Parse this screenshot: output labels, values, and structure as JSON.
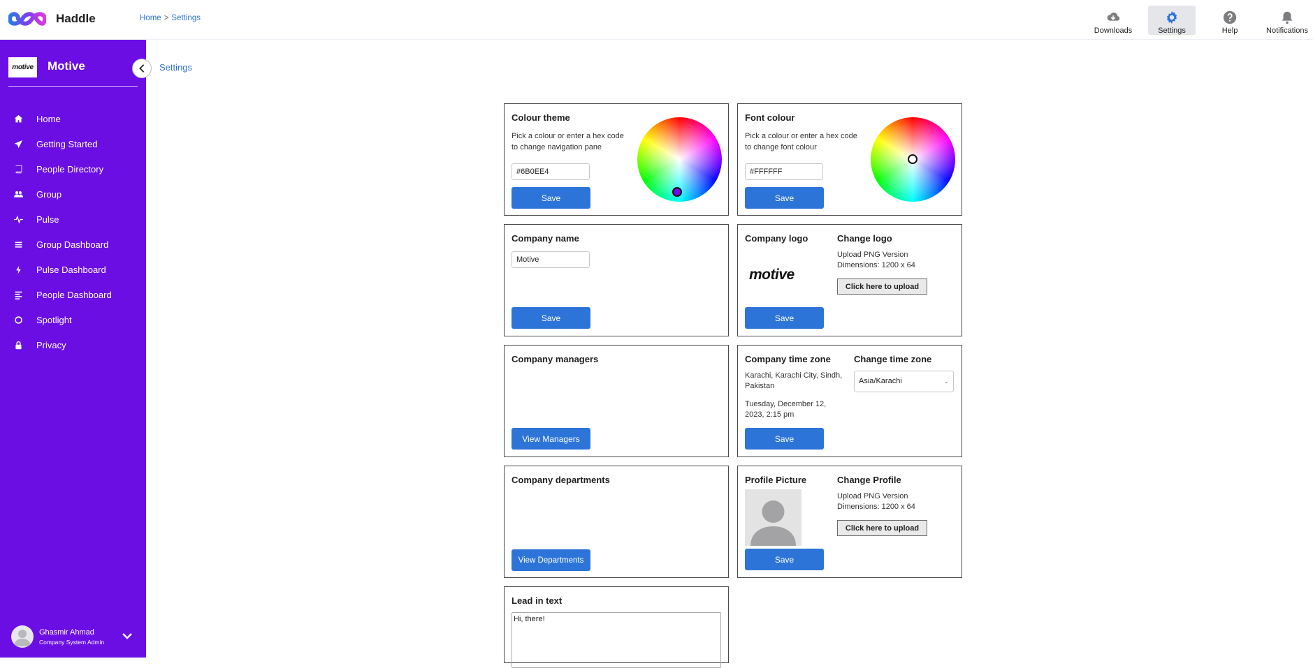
{
  "app": {
    "name": "Haddle"
  },
  "breadcrumb": {
    "home": "Home",
    "sep": ">",
    "current": "Settings"
  },
  "topnav": [
    {
      "label": "Downloads",
      "icon": "cloud-download-icon"
    },
    {
      "label": "Settings",
      "icon": "gear-icon",
      "active": true
    },
    {
      "label": "Help",
      "icon": "help-icon"
    },
    {
      "label": "Notifications",
      "icon": "bell-icon"
    }
  ],
  "sidebar": {
    "company_logo_text": "motive",
    "company_name": "Motive",
    "items": [
      {
        "label": "Home",
        "icon": "home-icon"
      },
      {
        "label": "Getting Started",
        "icon": "paper-plane-icon"
      },
      {
        "label": "People Directory",
        "icon": "book-icon"
      },
      {
        "label": "Group",
        "icon": "users-icon"
      },
      {
        "label": "Pulse",
        "icon": "pulse-icon"
      },
      {
        "label": "Group Dashboard",
        "icon": "list-icon"
      },
      {
        "label": "Pulse Dashboard",
        "icon": "bolt-icon"
      },
      {
        "label": "People Dashboard",
        "icon": "align-left-icon"
      },
      {
        "label": "Spotlight",
        "icon": "circle-icon"
      },
      {
        "label": "Privacy",
        "icon": "lock-icon"
      }
    ],
    "user": {
      "name": "Ghasmir Ahmad",
      "role": "Company System Admin"
    }
  },
  "page": {
    "title_link": "Settings"
  },
  "colour_theme": {
    "title": "Colour theme",
    "desc_line1": "Pick a colour or enter a hex code",
    "desc_line2": "to change navigation pane",
    "value": "#6B0EE4",
    "save": "Save"
  },
  "font_colour": {
    "title": "Font colour",
    "desc_line1": "Pick a colour or enter a hex code",
    "desc_line2": "to change font colour",
    "value": "#FFFFFF",
    "save": "Save"
  },
  "company_name": {
    "title": "Company name",
    "value": "Motive",
    "save": "Save"
  },
  "company_logo": {
    "title": "Company logo",
    "logo_text": "motive",
    "change_title": "Change logo",
    "upload_line1": "Upload PNG Version",
    "upload_line2": "Dimensions: 1200 x 64",
    "upload_button": "Click here to upload",
    "save": "Save"
  },
  "company_managers": {
    "title": "Company managers",
    "button": "View Managers"
  },
  "time_zone": {
    "title": "Company time zone",
    "location_line1": "Karachi, Karachi City, Sindh,",
    "location_line2": "Pakistan",
    "datetime_line1": "Tuesday, December 12,",
    "datetime_line2": "2023, 2:15 pm",
    "change_title": "Change time zone",
    "selected": "Asia/Karachi",
    "save": "Save"
  },
  "company_departments": {
    "title": "Company departments",
    "button": "View Departments"
  },
  "profile_picture": {
    "title": "Profile Picture",
    "change_title": "Change Profile",
    "upload_line1": "Upload PNG Version",
    "upload_line2": "Dimensions: 1200 x 64",
    "upload_button": "Click here to upload",
    "save": "Save"
  },
  "lead_in": {
    "title": "Lead in text",
    "value": "Hi, there!"
  },
  "colors": {
    "sidebar": "#6B0EE4",
    "primary_button": "#2D74D9",
    "link": "#2F74D8"
  }
}
